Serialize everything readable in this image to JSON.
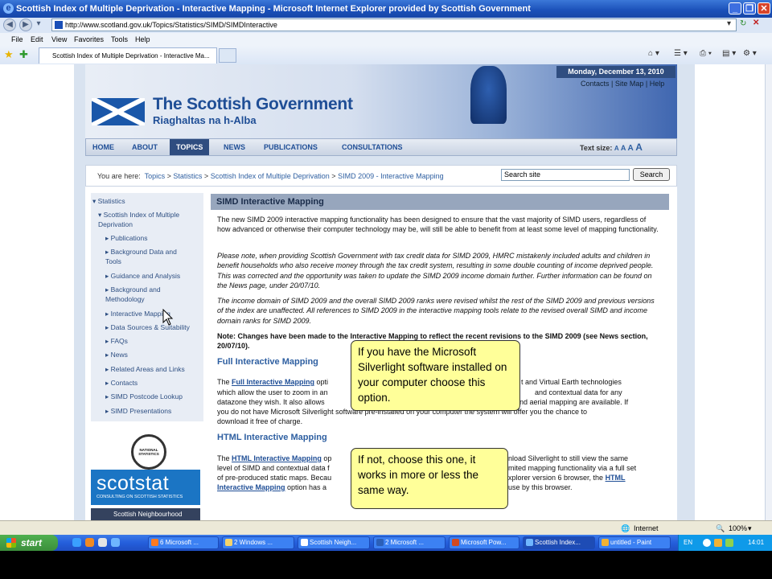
{
  "window": {
    "title": "Scottish Index of Multiple Deprivation - Interactive Mapping - Microsoft Internet Explorer provided by Scottish Government",
    "address": "http://www.scotland.gov.uk/Topics/Statistics/SIMD/SIMDInteractive",
    "menu": [
      "File",
      "Edit",
      "View",
      "Favorites",
      "Tools",
      "Help"
    ],
    "tab_title": "Scottish Index of Multiple Deprivation - Interactive Ma..."
  },
  "header": {
    "date": "Monday, December 13, 2010",
    "top_links": [
      "Contacts",
      "Site Map",
      "Help"
    ],
    "brand_line1": "The Scottish Government",
    "brand_line2": "Riaghaltas na h-Alba"
  },
  "nav": {
    "items": [
      "HOME",
      "ABOUT",
      "TOPICS",
      "NEWS",
      "PUBLICATIONS",
      "CONSULTATIONS"
    ],
    "active": "TOPICS",
    "text_size_label": "Text size:",
    "text_size_options": [
      "A",
      "A",
      "A",
      "A"
    ]
  },
  "breadcrumb": {
    "prefix": "You are here:",
    "items": [
      "Topics",
      "Statistics",
      "Scottish Index of Multiple Deprivation",
      "SIMD 2009 - Interactive Mapping"
    ],
    "separator": ">"
  },
  "search": {
    "placeholder": "Search site",
    "button": "Search"
  },
  "sidebar": {
    "items": [
      "Statistics",
      "Scottish Index of Multiple Deprivation",
      "Publications",
      "Background Data and Tools",
      "Guidance and Analysis",
      "Background and Methodology",
      "Interactive Mapping",
      "Data Sources & Suitability",
      "FAQs",
      "News",
      "Related Areas and Links",
      "Contacts",
      "SIMD Postcode Lookup",
      "SIMD Presentations"
    ],
    "logo_round": "NATIONAL STATISTICS",
    "scotstat": "scotstat",
    "scotstat_sub": "CONSULTING ON SCOTTISH STATISTICS",
    "sns": "Scottish Neighbourhood"
  },
  "content": {
    "heading": "SIMD Interactive Mapping",
    "p1": "The new SIMD 2009 interactive mapping functionality has been designed to ensure that the vast majority of SIMD users, regardless of how advanced or otherwise their computer technology may be, will still be able to benefit from at least some level of mapping functionality.",
    "p2": "Please note, when providing Scottish Government with tax credit data for SIMD 2009, HMRC mistakenly included adults and children in benefit households who also receive money through the tax credit system, resulting in some double counting of income deprived people. This was corrected and the opportunity was taken to update the SIMD 2009 income domain further. Further information can be found on the News page, under 20/07/10.",
    "p3": "The income domain of SIMD 2009 and the overall SIMD 2009 ranks were revised whilst the rest of the SIMD 2009 and previous versions of the index are unaffected. All references to SIMD 2009 in the interactive mapping tools relate to the revised overall SIMD and income domain ranks for SIMD 2009.",
    "note": "Note: Changes have been made to the Interactive Mapping to reflect the recent revisions to the SIMD 2009 (see News section, 20/07/10).",
    "full_heading": "Full Interactive Mapping",
    "full_p_start": "The ",
    "full_link": "Full Interactive Mapping",
    "full_p_l1": " opti",
    "full_p_l1b": "t and Virtual Earth technologies",
    "full_p_l2": "which allow the user to zoom in an",
    "full_p_l2b": "and contextual data for any",
    "full_p_l3": "datazone they wish. It also allows",
    "full_p_l3b": "nd aerial mapping are available. If",
    "full_p_l4": "you do not have Microsoft Silverlight software pre-installed on your computer the system will offer you the chance to",
    "full_p_l5": "download it free of charge.",
    "html_heading": "HTML Interactive Mapping",
    "html_p_start": "The ",
    "html_link": "HTML Interactive Mapping",
    "html_p_l1": " op",
    "html_p_l1b": "nload Silverlight to still view the same",
    "html_p_l2": "level of SIMD and contextual data f",
    "html_p_l2b": "mited mapping functionality via a full set",
    "html_p_l3": "of pre-produced static maps. Becau",
    "html_p_l3b": "xplorer version 6 browser, the ",
    "html_link2": "HTML",
    "html_link3": "Interactive Mapping",
    "html_p_l4": " option has a",
    "html_p_l4b": "use by this browser."
  },
  "callouts": {
    "first": "If you have the Microsoft Silverlight software installed on your computer choose this option.",
    "second": "If not, choose this one, it works in more or less the same way."
  },
  "statusbar": {
    "zone": "Internet",
    "zoom": "100%"
  },
  "taskbar": {
    "start": "start",
    "buttons": [
      "6 Microsoft ...",
      "2 Windows ...",
      "Scottish Neigh...",
      "2 Microsoft ...",
      "Microsoft Pow...",
      "Scottish Index...",
      "untitled - Paint"
    ],
    "lang": "EN",
    "time": "14:01"
  }
}
